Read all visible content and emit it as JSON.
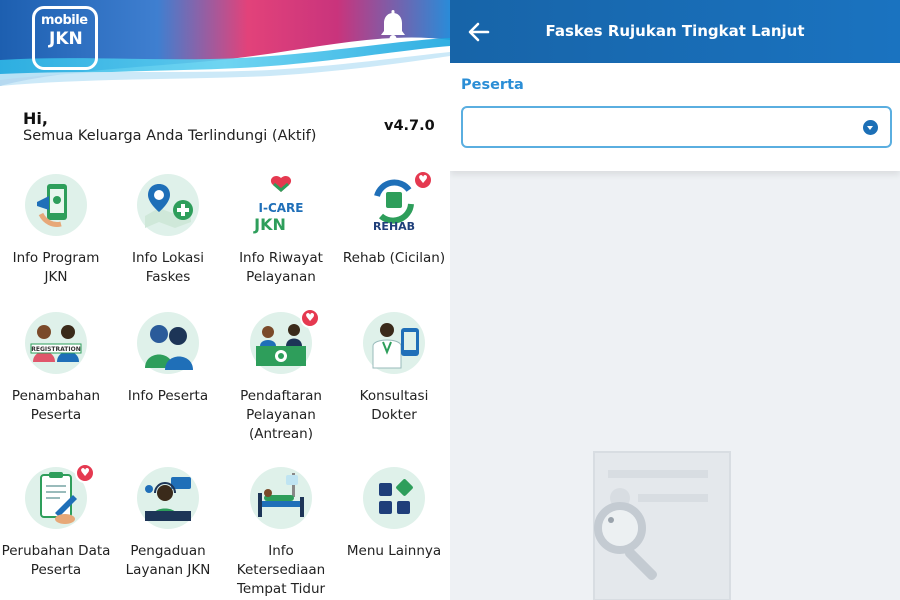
{
  "home": {
    "logo": {
      "line1": "mobile",
      "line2": "JKN"
    },
    "greeting": "Hi,",
    "status": "Semua Keluarga Anda Terlindungi (Aktif)",
    "version": "v4.7.0",
    "menu": [
      {
        "label": "Info Program JKN",
        "icon": "phone-megaphone-icon",
        "badge": false
      },
      {
        "label": "Info Lokasi Faskes",
        "icon": "map-pin-icon",
        "badge": false
      },
      {
        "label": "Info Riwayat Pelayanan",
        "icon": "icare-jkn-icon",
        "badge": false,
        "logo_text": "I-CARE JKN"
      },
      {
        "label": "Rehab (Cicilan)",
        "icon": "rehab-icon",
        "badge": true,
        "logo_text": "REHAB"
      },
      {
        "label": "Penambahan Peserta",
        "icon": "registration-icon",
        "badge": false,
        "logo_text": "REGISTRATION"
      },
      {
        "label": "Info Peserta",
        "icon": "participants-icon",
        "badge": false
      },
      {
        "label": "Pendaftaran Pelayanan (Antrean)",
        "icon": "queue-desk-icon",
        "badge": true
      },
      {
        "label": "Konsultasi Dokter",
        "icon": "doctor-icon",
        "badge": false
      },
      {
        "label": "Perubahan Data Peserta",
        "icon": "clipboard-edit-icon",
        "badge": true
      },
      {
        "label": "Pengaduan Layanan JKN",
        "icon": "call-center-icon",
        "badge": false
      },
      {
        "label": "Info Ketersediaan Tempat Tidur",
        "icon": "hospital-bed-icon",
        "badge": false
      },
      {
        "label": "Menu Lainnya",
        "icon": "grid-menu-icon",
        "badge": false
      }
    ]
  },
  "referral": {
    "title": "Faskes Rujukan Tingkat Lanjut",
    "field_label": "Peserta",
    "select_value": ""
  },
  "colors": {
    "primary": "#1a73c0",
    "accent_green": "#2e9e5b",
    "badge_red": "#e53950",
    "label_blue": "#2b8ed6"
  }
}
